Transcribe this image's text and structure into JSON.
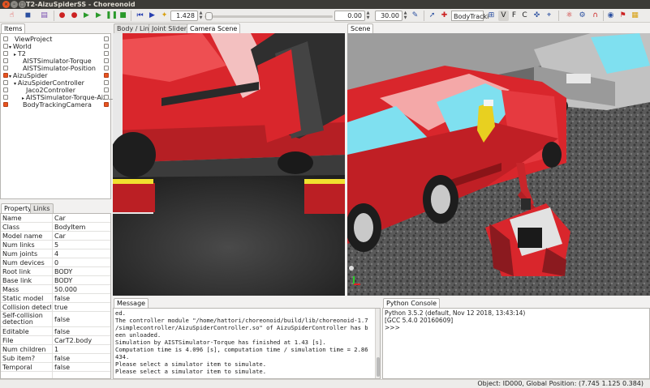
{
  "window": {
    "title": "T2-AizuSpiderSS - Choreonoid"
  },
  "toolbar": {
    "time_value": "1.428",
    "start_time": "0.00",
    "end_time": "30.00",
    "body_tracking_label": "BodyTracki",
    "v_label": "V",
    "f_label": "F",
    "c_label": "C"
  },
  "items_panel": {
    "tab": "Items",
    "tree": [
      {
        "label": "ViewProject",
        "checked": false,
        "right_checked": false
      },
      {
        "label": "World",
        "checked": false,
        "right_checked": false
      },
      {
        "label": "T2",
        "checked": false,
        "right_checked": false
      },
      {
        "label": "AISTSimulator-Torque",
        "checked": false,
        "right_checked": false
      },
      {
        "label": "AISTSimulator-Position",
        "checked": false,
        "right_checked": false
      },
      {
        "label": "AizuSpider",
        "checked": true,
        "right_checked": true
      },
      {
        "label": "AizuSpiderController",
        "checked": false,
        "right_checked": false
      },
      {
        "label": "Jaco2Controller",
        "checked": false,
        "right_checked": false
      },
      {
        "label": "AISTSimulator-Torque-Aiz…",
        "checked": false,
        "right_checked": false
      },
      {
        "label": "BodyTrackingCamera",
        "checked": true,
        "right_checked": true
      }
    ]
  },
  "property_panel": {
    "tabs": [
      "Property",
      "Links"
    ],
    "rows": [
      {
        "key": "Name",
        "value": "Car"
      },
      {
        "key": "Class",
        "value": "BodyItem"
      },
      {
        "key": "Model name",
        "value": "Car"
      },
      {
        "key": "Num links",
        "value": "5"
      },
      {
        "key": "Num joints",
        "value": "4"
      },
      {
        "key": "Num devices",
        "value": "0"
      },
      {
        "key": "Root link",
        "value": "BODY"
      },
      {
        "key": "Base link",
        "value": "BODY"
      },
      {
        "key": "Mass",
        "value": "50.000"
      },
      {
        "key": "Static model",
        "value": "false"
      },
      {
        "key": "Collision detection",
        "value": "true"
      },
      {
        "key": "Self-collision detection",
        "value": "false"
      },
      {
        "key": "Editable",
        "value": "false"
      },
      {
        "key": "File",
        "value": "CarT2.body"
      },
      {
        "key": "Num children",
        "value": "1"
      },
      {
        "key": "Sub item?",
        "value": "false"
      },
      {
        "key": "Temporal",
        "value": "false"
      }
    ]
  },
  "camera_view": {
    "tabs": [
      "Body / Link",
      "Joint Sliders",
      "Camera Scene"
    ]
  },
  "scene_view": {
    "tab": "Scene"
  },
  "message_panel": {
    "tab": "Message",
    "lines": [
      "ed.",
      "The controller module \"/home/hattori/choreonoid/build/lib/choreonoid-1.7",
      "/simplecontroller/AizuSpiderController.so\" of AizuSpiderController has b",
      "een unloaded.",
      "Simulation by AISTSimulator-Torque has finished at 1.43 [s].",
      "Computation time is 4.096 [s], computation time / simulation time = 2.86",
      "434.",
      "Please select a simulator item to simulate.",
      "Please select a simulator item to simulate."
    ]
  },
  "python_console": {
    "tab": "Python Console",
    "lines": [
      "Python 3.5.2 (default, Nov 12 2018, 13:43:14)",
      "[GCC 5.4.0 20160609]",
      ">>>"
    ]
  },
  "status_bar": {
    "text": "Object: ID000, Global Position: (7.745 1.125 0.384)"
  },
  "colors": {
    "car_red": "#d9262c",
    "checkbox_on": "#e95420",
    "titlebar": "#3c3b37"
  }
}
